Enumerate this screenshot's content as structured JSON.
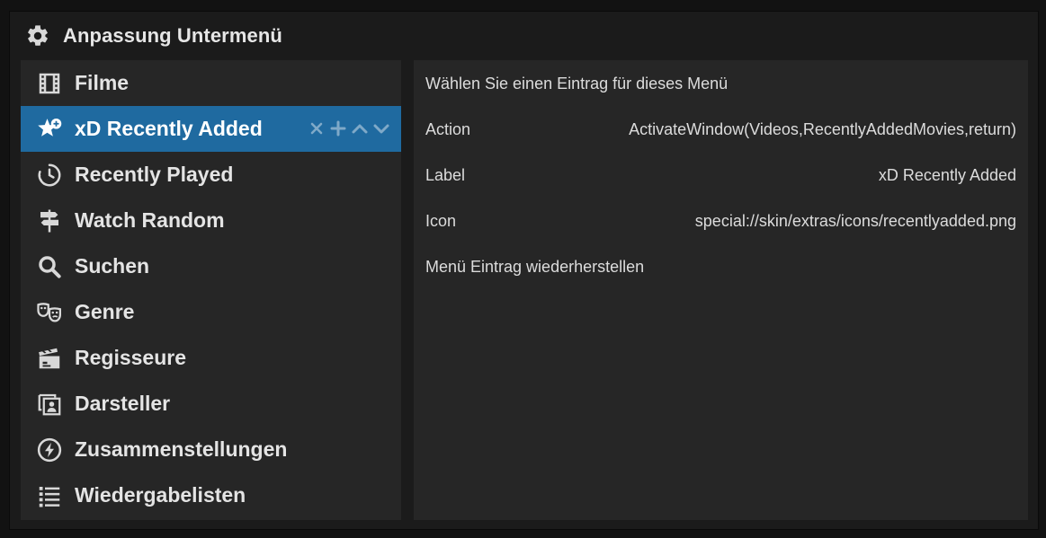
{
  "dialog": {
    "title": "Anpassung Untermenü",
    "title_icon": "gear-icon"
  },
  "menu": {
    "items": [
      {
        "label": "Filme",
        "icon": "film-icon"
      },
      {
        "label": "xD Recently Added",
        "icon": "star-plus-icon",
        "selected": true
      },
      {
        "label": "Recently Played",
        "icon": "history-icon"
      },
      {
        "label": "Watch Random",
        "icon": "signpost-icon"
      },
      {
        "label": "Suchen",
        "icon": "search-icon"
      },
      {
        "label": "Genre",
        "icon": "theater-masks-icon"
      },
      {
        "label": "Regisseure",
        "icon": "clapperboard-icon"
      },
      {
        "label": "Darsteller",
        "icon": "portrait-icon"
      },
      {
        "label": "Zusammenstellungen",
        "icon": "lightning-circle-icon"
      },
      {
        "label": "Wiedergabelisten",
        "icon": "list-icon"
      }
    ],
    "item_actions": [
      "close-icon",
      "plus-icon",
      "chevron-up-icon",
      "chevron-down-icon"
    ]
  },
  "details": {
    "select_entry": "Wählen Sie einen Eintrag für dieses Menü",
    "action_label": "Action",
    "action_value": "ActivateWindow(Videos,RecentlyAddedMovies,return)",
    "label_label": "Label",
    "label_value": "xD Recently Added",
    "icon_label": "Icon",
    "icon_value": "special://skin/extras/icons/recentlyadded.png",
    "restore": "Menü Eintrag wiederherstellen"
  },
  "colors": {
    "selected_bg": "#1f6aa0",
    "panel_bg": "#262626",
    "dialog_bg": "#1b1b1b"
  }
}
